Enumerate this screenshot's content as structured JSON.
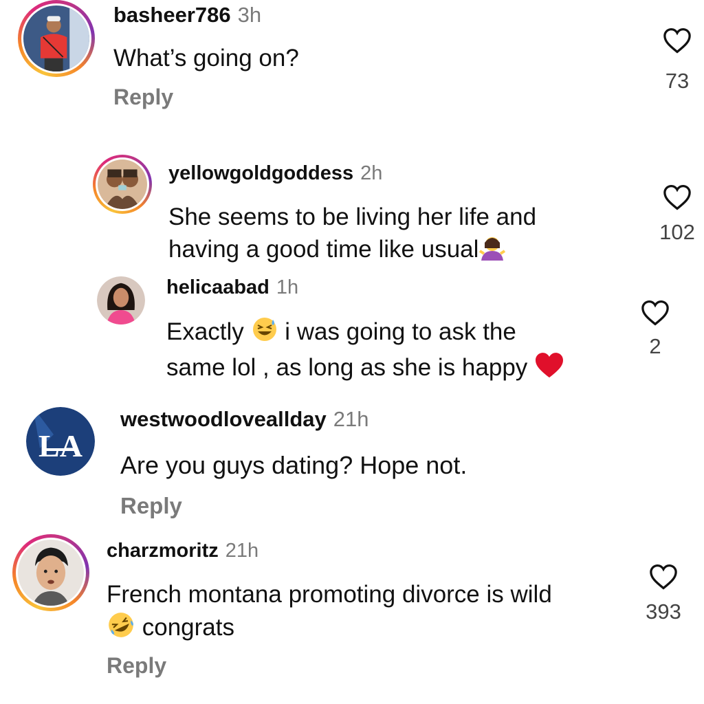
{
  "comments": [
    {
      "username": "basheer786",
      "time": "3h",
      "text": "What’s going on?",
      "reply": "Reply",
      "likes": "73",
      "avatar": "man-red-shirt-avatar"
    },
    {
      "username": "yellowgoldgoddess",
      "time": "2h",
      "text_line1": "She seems to be living her life and",
      "text_line2": "having a good time like usual",
      "emoji": "woman-shrugging-emoji",
      "likes": "102",
      "avatar": "two-women-avatar"
    },
    {
      "username": "helicaabad",
      "time": "1h",
      "text_part1": "Exactly",
      "emoji1": "grinning-sweat-emoji",
      "text_part2": "i was going to ask the",
      "text_line2": "same lol , as long as she is happy",
      "emoji2": "red-heart-emoji",
      "likes": "2",
      "avatar": "woman-pink-top-avatar"
    },
    {
      "username": "westwoodloveallday",
      "time": "21h",
      "text": "Are you guys dating?  Hope not.",
      "reply": "Reply",
      "avatar": "dodgers-la-logo-avatar"
    },
    {
      "username": "charzmoritz",
      "time": "21h",
      "text_line1": "French montana promoting divorce is wild",
      "emoji": "rolling-laughing-emoji",
      "text_line2": "congrats",
      "reply": "Reply",
      "likes": "393",
      "avatar": "young-man-avatar"
    }
  ],
  "colors": {
    "text": "#111111",
    "meta": "#7a7a7a",
    "heart": "#111111",
    "ring_start": "#f9c33a",
    "ring_end": "#c13584",
    "dodgers_blue": "#1c3f7a"
  }
}
